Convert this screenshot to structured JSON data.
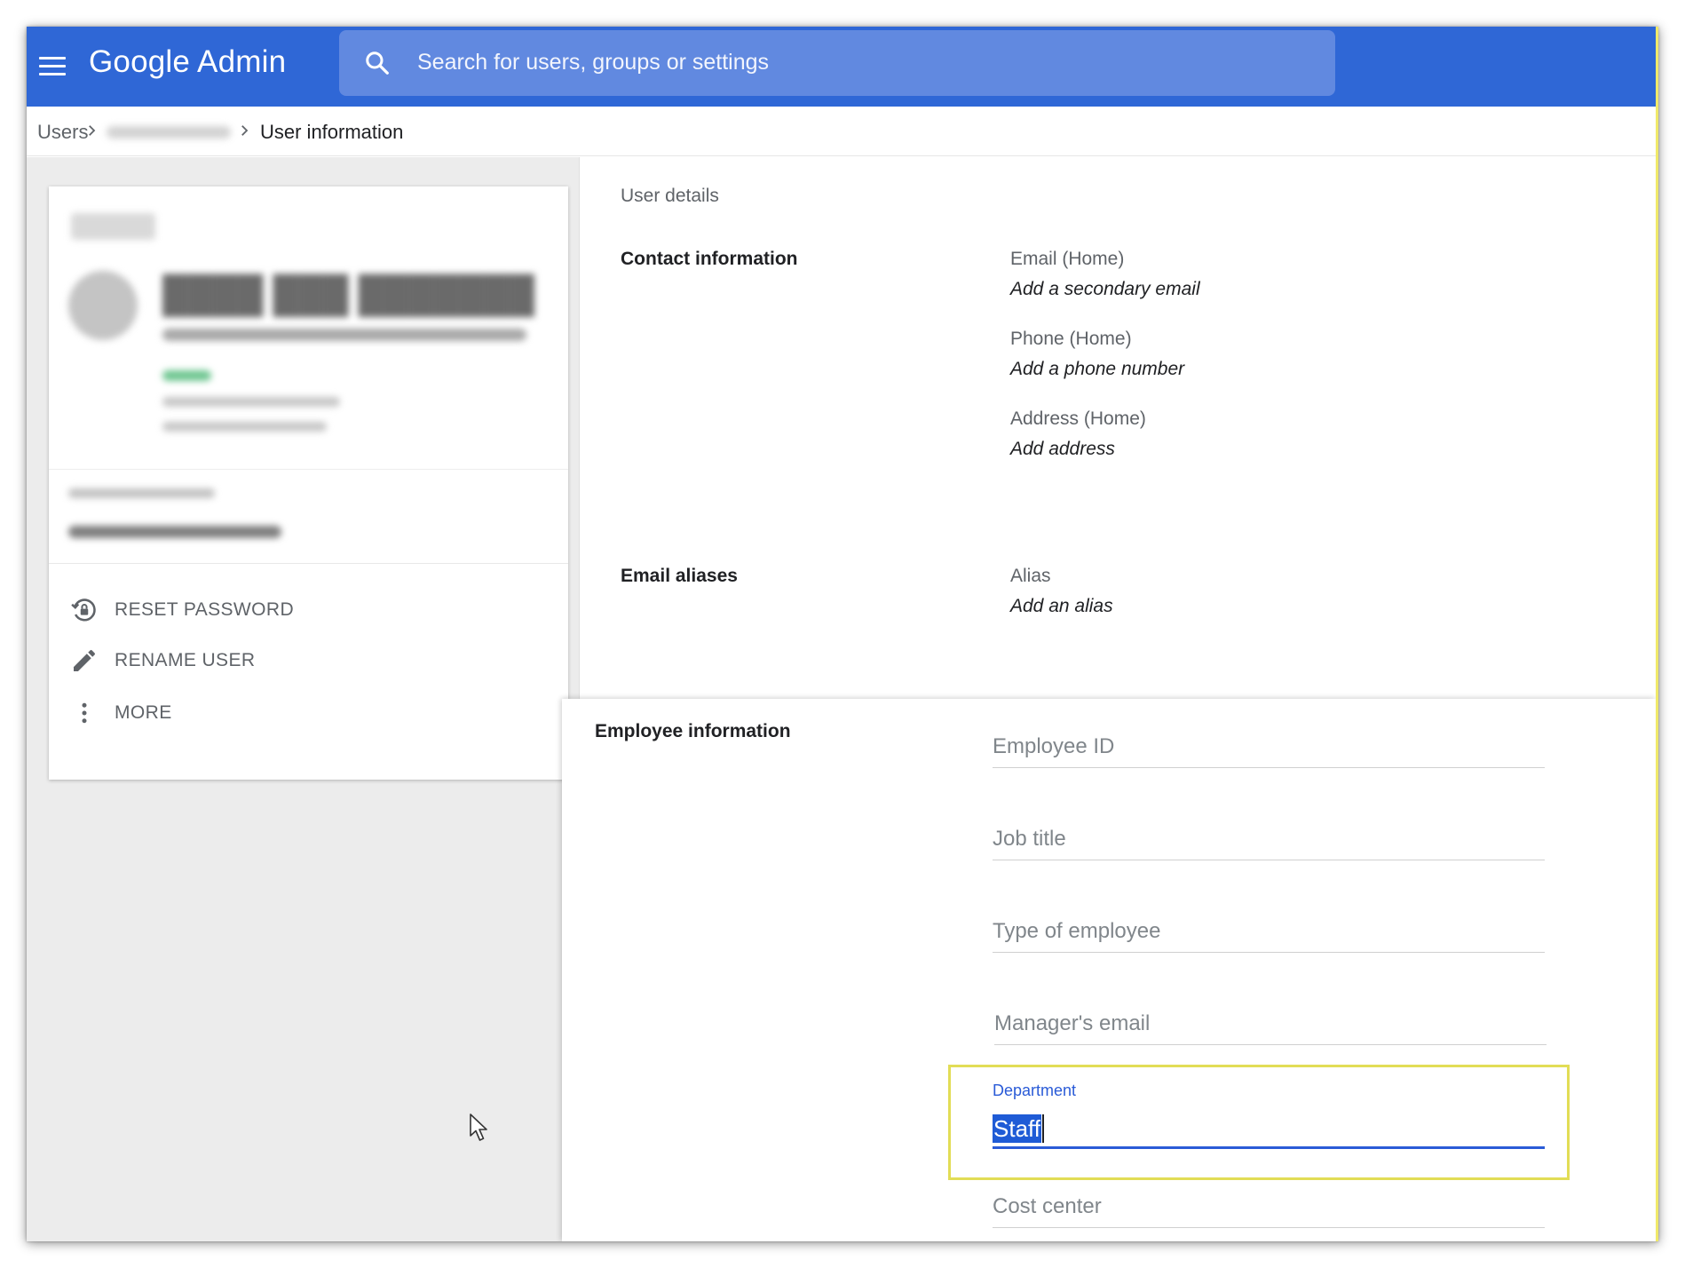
{
  "topbar": {
    "menu_icon": "hamburger-menu-icon",
    "brand": "Google Admin",
    "search_icon": "search-icon",
    "search_placeholder": "Search for users, groups or settings",
    "accent_color": "#2f67d6"
  },
  "breadcrumb": {
    "root": "Users",
    "current": "User information",
    "chevron_icon": "chevron-right-icon"
  },
  "user_card": {
    "actions": [
      {
        "label": "RESET PASSWORD",
        "icon": "lock-reset-icon"
      },
      {
        "label": "RENAME USER",
        "icon": "pencil-icon"
      },
      {
        "label": "MORE",
        "icon": "more-vert-icon"
      }
    ]
  },
  "user_details": {
    "heading": "User details",
    "contact": {
      "title": "Contact information",
      "fields": [
        {
          "label": "Email (Home)",
          "value": "Add a secondary email"
        },
        {
          "label": "Phone (Home)",
          "value": "Add a phone number"
        },
        {
          "label": "Address (Home)",
          "value": "Add address"
        }
      ]
    },
    "aliases": {
      "title": "Email aliases",
      "label": "Alias",
      "value": "Add an alias"
    }
  },
  "employee": {
    "title": "Employee information",
    "fields": [
      "Employee ID",
      "Job title",
      "Type of employee",
      "Manager's email"
    ],
    "department": {
      "label": "Department",
      "value": "Staff",
      "highlight_color": "#e2dd56"
    },
    "cost_center": "Cost center"
  }
}
